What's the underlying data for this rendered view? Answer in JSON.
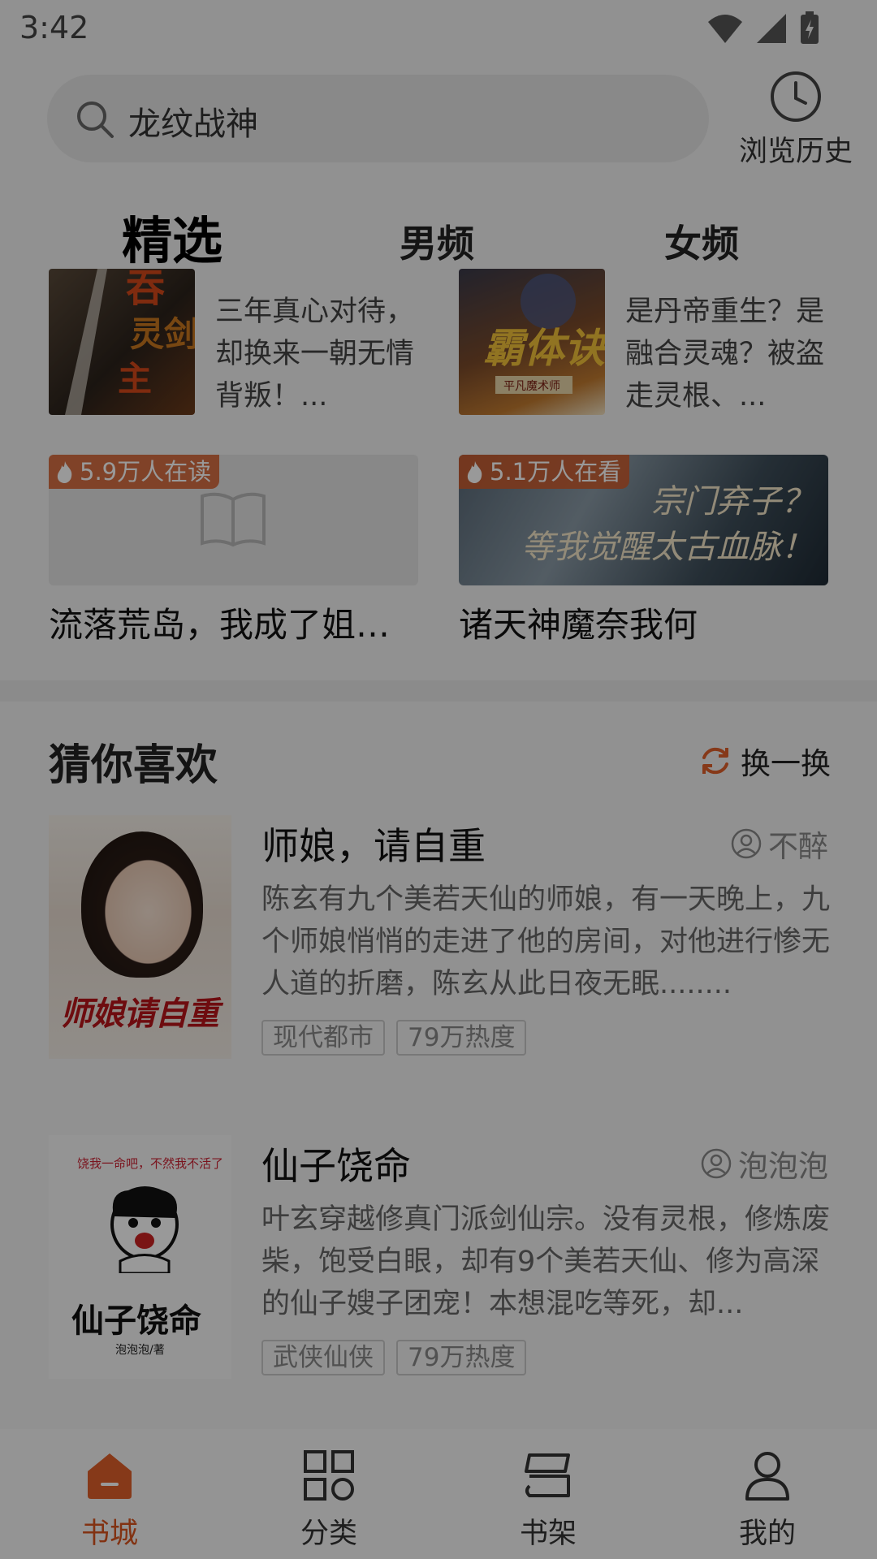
{
  "status_bar": {
    "time": "3:42"
  },
  "search": {
    "query": "龙纹战神",
    "icon": "search-icon"
  },
  "history": {
    "label": "浏览历史",
    "icon": "clock-icon"
  },
  "tabs": [
    {
      "label": "精选",
      "active": true
    },
    {
      "label": "男频",
      "active": false
    },
    {
      "label": "女频",
      "active": false
    }
  ],
  "featured": [
    {
      "desc": "三年真心对待，却换来一朝无情背叛！..."
    },
    {
      "desc": "是丹帝重生？是融合灵魂？被盗走灵根、..."
    }
  ],
  "banners": [
    {
      "badge": "5.9万人在读",
      "title": "流落荒岛，我成了姐姐..."
    },
    {
      "badge": "5.1万人在看",
      "title": "诸天神魔奈我何",
      "art_text_1": "宗门弃子？",
      "art_text_2": "等我觉醒太古血脉！"
    }
  ],
  "section": {
    "title": "猜你喜欢",
    "refresh_label": "换一换"
  },
  "recommendations": [
    {
      "title": "师娘，请自重",
      "author": "不醉",
      "desc": "陈玄有九个美若天仙的师娘，有一天晚上，九个师娘悄悄的走进了他的房间，对他进行惨无人道的折磨，陈玄从此日夜无眠........",
      "tags": [
        "现代都市",
        "79万热度"
      ],
      "cover_text": "师娘请自重"
    },
    {
      "title": "仙子饶命",
      "author": "泡泡泡",
      "desc": "叶玄穿越修真门派剑仙宗。没有灵根，修炼废柴，饱受白眼，却有9个美若天仙、修为高深的仙子嫂子团宠！本想混吃等死，却...",
      "tags": [
        "武侠仙侠",
        "79万热度"
      ],
      "cover_text": "仙子饶命",
      "cover_top_line": "饶我一命吧，不然我不活了",
      "cover_sub": "泡泡泡/著"
    }
  ],
  "bottom_nav": [
    {
      "label": "书城",
      "icon": "home-icon",
      "active": true
    },
    {
      "label": "分类",
      "icon": "grid-icon",
      "active": false
    },
    {
      "label": "书架",
      "icon": "bookshelf-icon",
      "active": false
    },
    {
      "label": "我的",
      "icon": "user-icon",
      "active": false
    }
  ],
  "colors": {
    "accent": "#d9541e",
    "badge": "#d25a28"
  }
}
